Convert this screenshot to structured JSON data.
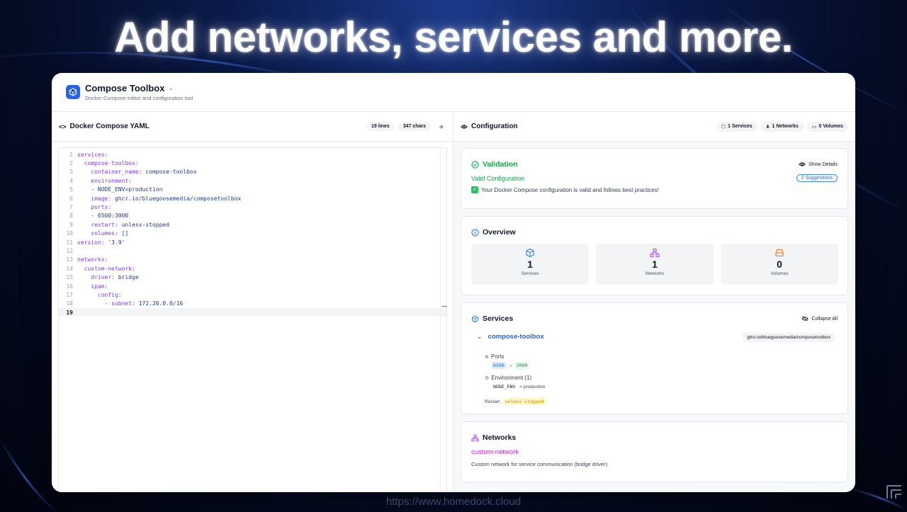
{
  "hero": {
    "title": "Add networks, services and more."
  },
  "footer": {
    "url": "https://www.homedock.cloud"
  },
  "app": {
    "title": "Compose Toolbox",
    "subtitle": "Docker Compose editor and configuration tool"
  },
  "editor_panel": {
    "title": "Docker Compose YAML",
    "lines_chip": "19 lines",
    "chars_chip": "347 chars",
    "add_label": "+",
    "lines": [
      {
        "n": "1",
        "indent": "",
        "key": "services:",
        "val": ""
      },
      {
        "n": "2",
        "indent": "  ",
        "key": "compose-toolbox:",
        "val": ""
      },
      {
        "n": "3",
        "indent": "    ",
        "key": "container_name:",
        "val": " compose-toolbox"
      },
      {
        "n": "4",
        "indent": "    ",
        "key": "environment:",
        "val": ""
      },
      {
        "n": "5",
        "indent": "    ",
        "key": "",
        "val": "- NODE_ENV=production"
      },
      {
        "n": "6",
        "indent": "    ",
        "key": "image:",
        "val": " ghcr.io/bluegoosemedia/composetoolbox"
      },
      {
        "n": "7",
        "indent": "    ",
        "key": "ports:",
        "val": ""
      },
      {
        "n": "8",
        "indent": "    ",
        "key": "",
        "val": "- 6500:3000"
      },
      {
        "n": "9",
        "indent": "    ",
        "key": "restart:",
        "val": " unless-stopped"
      },
      {
        "n": "10",
        "indent": "    ",
        "key": "volumes:",
        "val": " []"
      },
      {
        "n": "11",
        "indent": "",
        "key": "version:",
        "val": " '3.9'"
      },
      {
        "n": "12",
        "indent": "",
        "key": "",
        "val": ""
      },
      {
        "n": "13",
        "indent": "",
        "key": "networks:",
        "val": ""
      },
      {
        "n": "14",
        "indent": "  ",
        "key": "custom-network:",
        "val": ""
      },
      {
        "n": "15",
        "indent": "    ",
        "key": "driver:",
        "val": " bridge"
      },
      {
        "n": "16",
        "indent": "    ",
        "key": "ipam:",
        "val": ""
      },
      {
        "n": "17",
        "indent": "      ",
        "key": "config:",
        "val": ""
      },
      {
        "n": "18",
        "indent": "        ",
        "key": "- subnet:",
        "val": " 172.20.0.0/16"
      },
      {
        "n": "19",
        "indent": "",
        "key": "",
        "val": ""
      }
    ]
  },
  "config_panel": {
    "title": "Configuration",
    "services_chip": "1 Services",
    "networks_chip": "1 Networks",
    "volumes_chip": "0 Volumes"
  },
  "validation": {
    "title": "Validation",
    "show_details": "Show Details",
    "status": "Valid Configuration",
    "suggestions": "2 Suggestions",
    "message": "Your Docker Compose configuration is valid and follows best practices!"
  },
  "overview": {
    "title": "Overview",
    "stats": [
      {
        "value": "1",
        "label": "Services",
        "color": "#3b82f6"
      },
      {
        "value": "1",
        "label": "Networks",
        "color": "#a855f7"
      },
      {
        "value": "0",
        "label": "Volumes",
        "color": "#f97316"
      }
    ]
  },
  "services": {
    "title": "Services",
    "collapse_all": "Collapse All",
    "service": {
      "name": "compose-toolbox",
      "image": "ghcr.io/bluegoosemedia/composetoolbox",
      "ports_label": "Ports",
      "port_host": "6500",
      "port_arrow": "→",
      "port_container": "3000",
      "env_label": "Environment (1)",
      "env_key": "NODE_ENV",
      "env_value": "= production",
      "restart_label": "Restart:",
      "restart_value": "unless-stopped"
    }
  },
  "networks": {
    "title": "Networks",
    "name": "custom-network",
    "description": "Custom network for service communication (bridge driver)"
  },
  "colors": {
    "accent_blue": "#2563eb",
    "valid_green": "#16a34a",
    "network_purple": "#c026d3"
  }
}
